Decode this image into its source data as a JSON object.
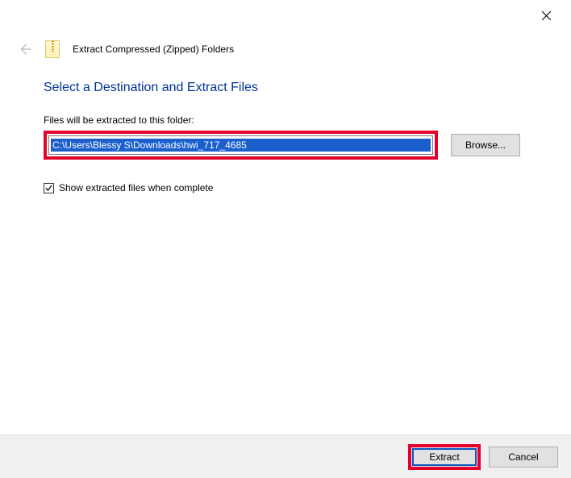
{
  "window": {
    "title": "Extract Compressed (Zipped) Folders"
  },
  "wizard": {
    "heading": "Select a Destination and Extract Files",
    "path_label": "Files will be extracted to this folder:",
    "path_value": "C:\\Users\\Blessy S\\Downloads\\hwi_717_4685",
    "browse_label": "Browse...",
    "show_files_label": "Show extracted files when complete",
    "show_files_checked": true
  },
  "actions": {
    "extract_label": "Extract",
    "cancel_label": "Cancel"
  }
}
